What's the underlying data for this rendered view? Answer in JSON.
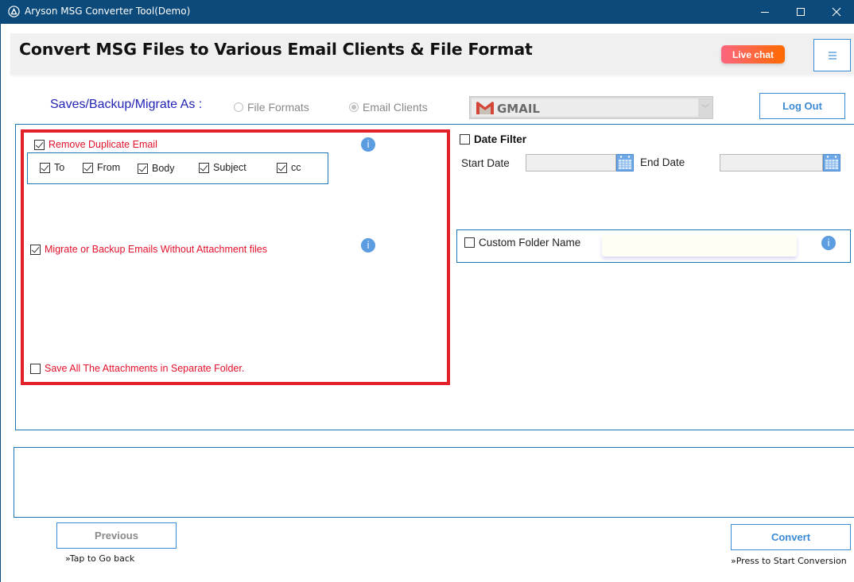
{
  "titlebar": {
    "title": "Aryson MSG Converter Tool(Demo)",
    "minimize_glyph": "—",
    "maximize_glyph": "☐",
    "close_glyph": "✕"
  },
  "banner": {
    "heading": "Convert MSG Files to Various Email Clients & File Format",
    "live_chat_label": "Live chat",
    "menu_glyph": "☰"
  },
  "saves": {
    "label": "Saves/Backup/Migrate As :",
    "options": [
      {
        "label": "File Formats",
        "selected": false
      },
      {
        "label": "Email Clients",
        "selected": true
      }
    ],
    "client_select": {
      "value": "GMAIL",
      "chevron_glyph": "﹀"
    },
    "logout_label": "Log Out"
  },
  "options": {
    "remove_duplicate": {
      "label": "Remove Duplicate Email",
      "checked": true
    },
    "duplicate_fields": [
      {
        "label": "To",
        "checked": true
      },
      {
        "label": "From",
        "checked": true
      },
      {
        "label": "Body",
        "checked": true
      },
      {
        "label": "Subject",
        "checked": true
      },
      {
        "label": "cc",
        "checked": true
      }
    ],
    "without_attachments": {
      "label": "Migrate or Backup Emails Without Attachment files",
      "checked": true
    },
    "save_attachments": {
      "label": "Save All The Attachments in Separate Folder.",
      "checked": false
    },
    "info_glyph": "i"
  },
  "date_filter": {
    "label": "Date Filter",
    "checked": false,
    "start_label": "Start Date",
    "start_value": "",
    "end_label": "End Date",
    "end_value": ""
  },
  "custom_folder": {
    "label": "Custom Folder Name",
    "checked": false,
    "value": ""
  },
  "footer": {
    "previous_label": "Previous",
    "previous_hint": "»Tap to Go back",
    "convert_label": "Convert",
    "convert_hint": "»Press to Start Conversion"
  },
  "colors": {
    "titlebar": "#0b4a7a",
    "accent_blue": "#3a8ad6",
    "panel_border": "#1b78b4",
    "highlight_red": "#e3212b",
    "option_text_red": "#e3102a",
    "saves_label": "#2323b5"
  }
}
